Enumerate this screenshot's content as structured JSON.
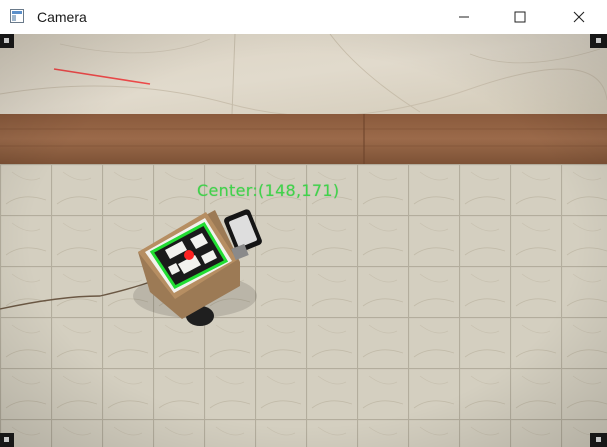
{
  "window": {
    "title": "Camera",
    "icon": "app-window-icon",
    "controls": {
      "minimize": "minimize-icon",
      "maximize": "maximize-icon",
      "close": "close-icon"
    }
  },
  "camera_feed": {
    "overlay_text": "Center:(148,171)",
    "overlay_color": "#3fd34a",
    "detection_box_color": "#22dd33",
    "center_marker_color": "#ff2222",
    "trajectory_color": "#ee4a4a"
  }
}
